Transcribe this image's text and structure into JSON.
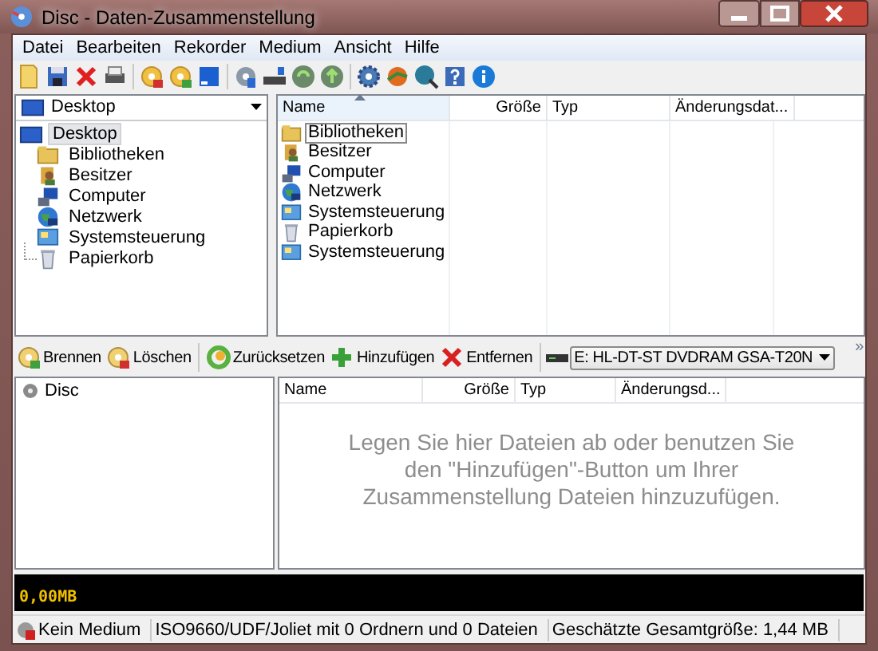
{
  "window": {
    "title": "Disc - Daten-Zusammenstellung"
  },
  "menu": [
    "Datei",
    "Bearbeiten",
    "Rekorder",
    "Medium",
    "Ansicht",
    "Hilfe"
  ],
  "folder_dropdown": {
    "value": "Desktop"
  },
  "folder_tree": {
    "label": "Desktop",
    "selected": true,
    "children": [
      {
        "label": "Bibliotheken",
        "selected": false
      },
      {
        "label": "Besitzer",
        "selected": false
      },
      {
        "label": "Computer",
        "selected": false
      },
      {
        "label": "Netzwerk",
        "selected": false
      },
      {
        "label": "Systemsteuerung",
        "selected": false
      },
      {
        "label": "Papierkorb",
        "selected": false
      }
    ]
  },
  "files": {
    "columns": [
      "Name",
      "Größe",
      "Typ",
      "Änderungsdat..."
    ],
    "rows": [
      {
        "name": "Bibliotheken",
        "selected": true
      },
      {
        "name": "Besitzer",
        "selected": false
      },
      {
        "name": "Computer",
        "selected": false
      },
      {
        "name": "Netzwerk",
        "selected": false
      },
      {
        "name": "Systemsteuerung",
        "selected": false
      },
      {
        "name": "Papierkorb",
        "selected": false
      },
      {
        "name": "Systemsteuerung",
        "selected": false
      }
    ]
  },
  "actions": [
    {
      "label": "Brennen",
      "kind": "button"
    },
    {
      "label": "Löschen",
      "kind": "button"
    },
    {
      "label": "Zurücksetzen",
      "kind": "button"
    },
    {
      "label": "Hinzufügen",
      "kind": "button"
    },
    {
      "label": "Entfernen",
      "kind": "button"
    },
    {
      "label": "E: HL-DT-ST DVDRAM GSA-T20N",
      "kind": "dropdown"
    }
  ],
  "actions_overflow": "»",
  "disc_tree": [
    {
      "label": "Disc"
    }
  ],
  "compilation": {
    "columns": [
      "Name",
      "Größe",
      "Typ",
      "Änderungsd..."
    ],
    "empty_message": "Legen Sie hier Dateien ab oder benutzen Sie den \"Hinzufügen\"-Button um Ihrer Zusammenstellung Dateien hinzuzufügen."
  },
  "capacity": {
    "reading": "0,00MB"
  },
  "status_bar": [
    "Kein Medium",
    "ISO9660/UDF/Joliet mit 0 Ordnern und 0 Dateien",
    "Geschätzte Gesamtgröße: 1,44 MB"
  ]
}
